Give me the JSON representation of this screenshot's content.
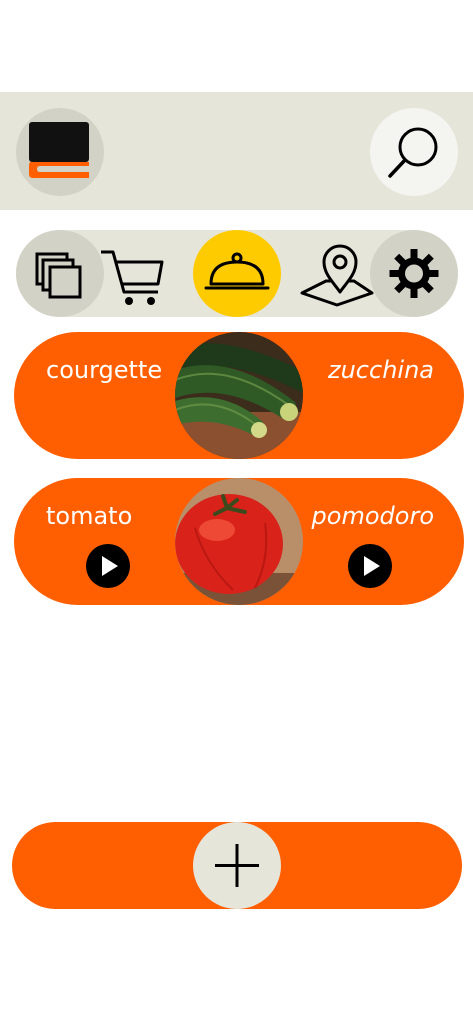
{
  "header": {
    "logo_icon": "book-icon",
    "search_icon": "search-icon"
  },
  "nav": {
    "items": [
      {
        "icon": "cards-icon",
        "active": false
      },
      {
        "icon": "cart-icon",
        "active": false
      },
      {
        "icon": "cloche-icon",
        "active": true
      },
      {
        "icon": "map-pin-icon",
        "active": false
      },
      {
        "icon": "gear-icon",
        "active": false
      }
    ]
  },
  "cards": [
    {
      "english": "courgette",
      "italian": "zucchina",
      "image": "zucchini-photo",
      "show_play": false
    },
    {
      "english": "tomato",
      "italian": "pomodoro",
      "image": "tomato-photo",
      "show_play": true
    }
  ],
  "add_bar": {
    "icon": "plus-icon"
  },
  "colors": {
    "accent": "#ff5f00",
    "active_nav": "#fecb00",
    "header_bg": "#e6e5da",
    "button_bg": "#d3d2c6"
  }
}
